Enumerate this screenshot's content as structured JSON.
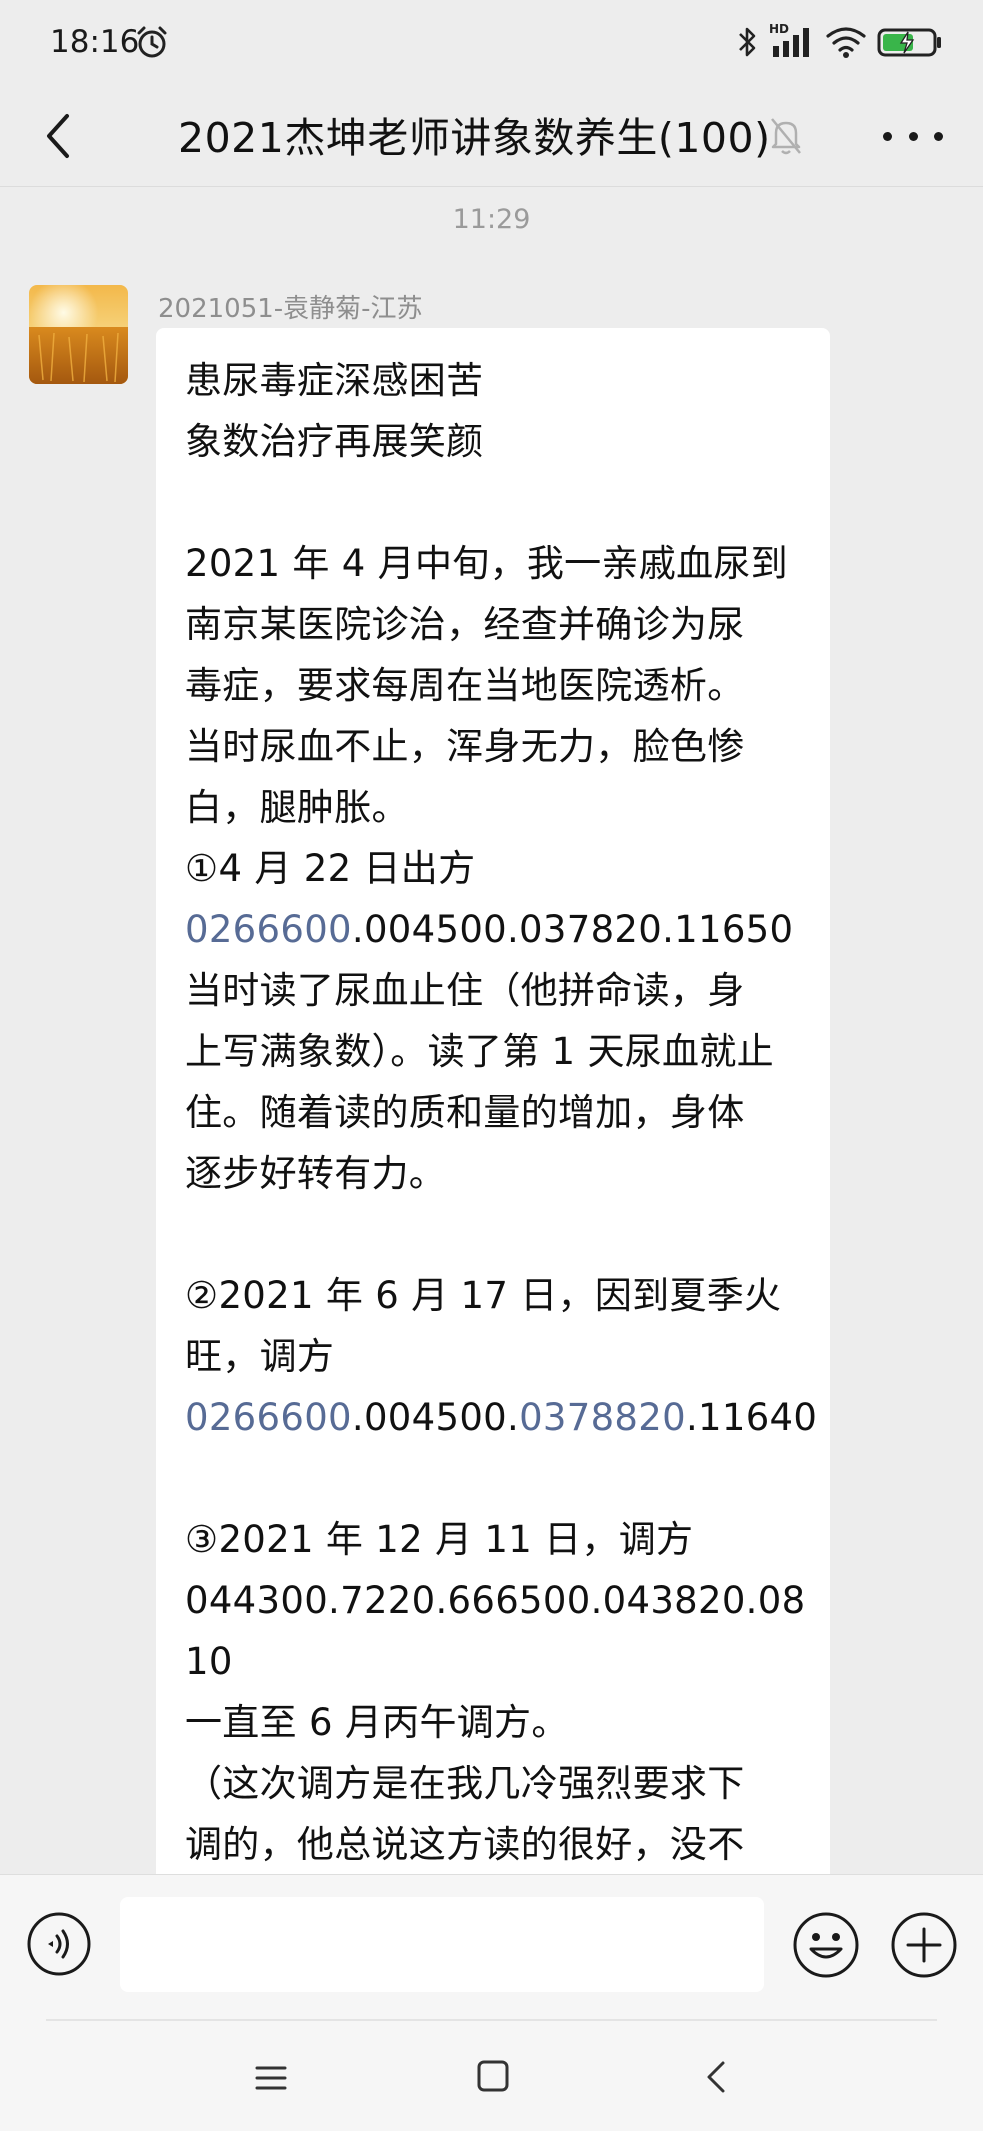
{
  "status_bar": {
    "time": "18:16",
    "network_label": "HD"
  },
  "header": {
    "title": "2021杰坤老师讲象数养生(100)"
  },
  "chat": {
    "timestamp": "11:29",
    "message": {
      "sender": "2021051-袁静菊-江苏",
      "lines": [
        [
          {
            "t": "患尿毒症深感困苦"
          }
        ],
        [
          {
            "t": "象数治疗再展笑颜"
          }
        ],
        [
          {
            "t": ""
          }
        ],
        [
          {
            "t": "2021 年 4 月中旬，我一亲戚血尿到"
          }
        ],
        [
          {
            "t": "南京某医院诊治，经查并确诊为尿"
          }
        ],
        [
          {
            "t": "毒症，要求每周在当地医院透析。"
          }
        ],
        [
          {
            "t": "当时尿血不止，浑身无力，脸色惨"
          }
        ],
        [
          {
            "t": "白，腿肿胀。"
          }
        ],
        [
          {
            "t": "①4 月 22 日出方"
          }
        ],
        [
          {
            "t": "0266600",
            "link": true
          },
          {
            "t": ".004500.037820.11650"
          }
        ],
        [
          {
            "t": "当时读了尿血止住（他拼命读，身"
          }
        ],
        [
          {
            "t": "上写满象数）。读了第 1 天尿血就止"
          }
        ],
        [
          {
            "t": "住。随着读的质和量的增加，身体"
          }
        ],
        [
          {
            "t": "逐步好转有力。"
          }
        ],
        [
          {
            "t": ""
          }
        ],
        [
          {
            "t": "②2021 年 6 月 17 日，因到夏季火"
          }
        ],
        [
          {
            "t": "旺，调方"
          }
        ],
        [
          {
            "t": "0266600",
            "link": true
          },
          {
            "t": ".004500."
          },
          {
            "t": "0378820",
            "link": true
          },
          {
            "t": ".11640"
          }
        ],
        [
          {
            "t": ""
          }
        ],
        [
          {
            "t": "③2021 年 12 月 11 日，调方"
          }
        ],
        [
          {
            "t": "044300.7220.666500.043820.08"
          }
        ],
        [
          {
            "t": "10"
          }
        ],
        [
          {
            "t": "一直至 6 月丙午调方。"
          }
        ],
        [
          {
            "t": "（这次调方是在我几冷强烈要求下"
          }
        ],
        [
          {
            "t": "调的，他总说这方读的很好，没不"
          }
        ]
      ]
    }
  },
  "input_bar": {
    "placeholder": ""
  },
  "colors": {
    "link": "#576b95",
    "background": "#ededed",
    "bubble": "#ffffff",
    "battery": "#39b54a"
  }
}
